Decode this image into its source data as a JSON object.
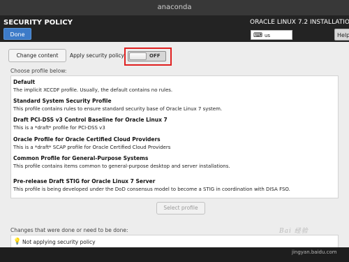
{
  "window": {
    "title": "anaconda"
  },
  "header": {
    "spoke_title": "SECURITY POLICY",
    "done_label": "Done",
    "product_title": "ORACLE LINUX 7.2 INSTALLATION",
    "keyboard_layout": "us",
    "help_label": "Help!"
  },
  "controls": {
    "change_content_label": "Change content",
    "apply_label": "Apply security policy:",
    "toggle_state": "OFF",
    "accent_color": "#e02020"
  },
  "profiles": {
    "heading": "Choose profile below:",
    "items": [
      {
        "title": "Default",
        "desc": "The implicit XCCDF profile. Usually, the default contains no rules."
      },
      {
        "title": "Standard System Security Profile",
        "desc": "This profile contains rules to ensure standard security base of Oracle Linux 7 system."
      },
      {
        "title": "Draft PCI-DSS v3 Control Baseline for Oracle Linux 7",
        "desc": "This is a *draft* profile for PCI-DSS v3"
      },
      {
        "title": "Oracle Profile for Oracle Certified Cloud Providers",
        "desc": "This is a *draft* SCAP profile for Oracle Certified Cloud Providers"
      },
      {
        "title": "Common Profile for General-Purpose Systems",
        "desc": "This profile contains items common to general-purpose desktop and server installations."
      },
      {
        "title": "Pre-release Draft STIG for Oracle Linux 7 Server",
        "desc": "This profile is being developed under the DoD consensus model to become a STIG in coordination with DISA FSO."
      }
    ],
    "select_label": "Select profile"
  },
  "changes": {
    "heading": "Changes that were done or need to be done:",
    "items": [
      {
        "icon": "bulb-icon",
        "text": "Not applying security policy"
      }
    ]
  },
  "watermark": {
    "logo_text": "Bai 经验",
    "url": "jingyan.baidu.com"
  }
}
